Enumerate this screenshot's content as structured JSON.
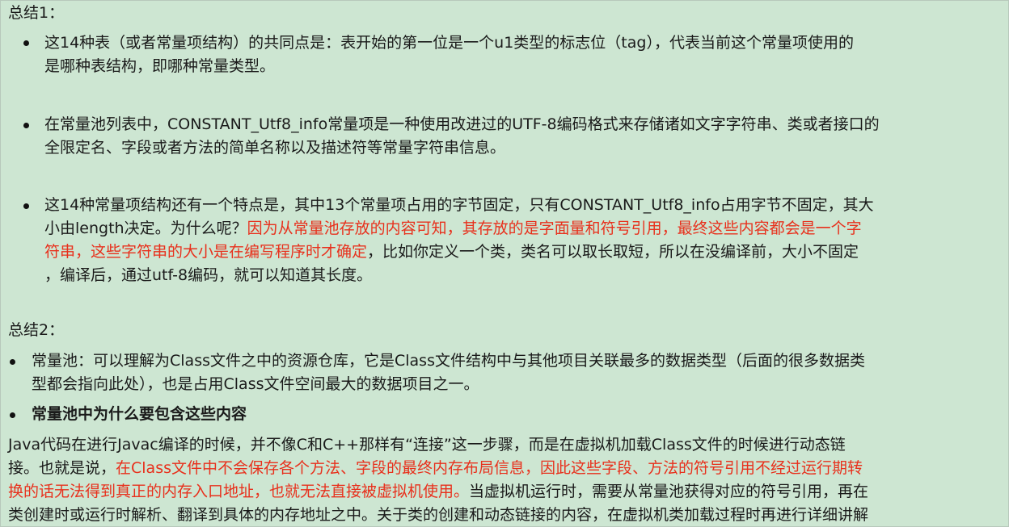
{
  "summary1": {
    "heading": "总结1：",
    "items": [
      {
        "lines": [
          "这14种表（或者常量项结构）的共同点是：表开始的第一位是一个u1类型的标志位（tag），代表当前这个常量项使用的",
          "是哪种表结构，即哪种常量类型。"
        ]
      },
      {
        "lines": [
          "在常量池列表中，CONSTANT_Utf8_info常量项是一种使用改进过的UTF-8编码格式来存储诸如文字字符串、类或者接口的",
          "全限定名、字段或者方法的简单名称以及描述符等常量字符串信息。"
        ]
      },
      {
        "line1": "这14种常量项结构还有一个特点是，其中13个常量项占用的字节固定，只有CONSTANT_Utf8_info占用字节不固定，其大",
        "line2_black": "小由length决定。为什么呢？",
        "line2_red": "因为从常量池存放的内容可知，其存放的是字面量和符号引用，最终这些内容都会是一个字",
        "line3_red": "符串，这些字符串的大小是在编写程序时才确定",
        "line3_black": "，比如你定义一个类，类名可以取长取短，所以在没编译前，大小不固定",
        "line4": "，编译后，通过utf-8编码，就可以知道其长度。"
      }
    ]
  },
  "summary2": {
    "heading": "总结2：",
    "item1_lines": [
      "常量池：可以理解为Class文件之中的资源仓库，它是Class文件结构中与其他项目关联最多的数据类型（后面的很多数据类",
      "型都会指向此处），也是占用Class文件空间最大的数据项目之一。"
    ],
    "item2": "常量池中为什么要包含这些内容",
    "para_line1": "Java代码在进行Javac编译的时候，并不像C和C++那样有“连接”这一步骤，而是在虚拟机加载Class文件的时候进行动态链",
    "para_line2_black": "接。也就是说，",
    "para_line2_red": "在Class文件中不会保存各个方法、字段的最终内存布局信息，因此这些字段、方法的符号引用不经过运行期转",
    "para_line3_red": "换的话无法得到真正的内存入口地址，也就无法直接被虚拟机使用。",
    "para_line3_black": "当虚拟机运行时，需要从常量池获得对应的符号引用，再在",
    "para_line4": "类创建时或运行时解析、翻译到具体的内存地址之中。关于类的创建和动态链接的内容，在虚拟机类加载过程时再进行详细讲解"
  }
}
